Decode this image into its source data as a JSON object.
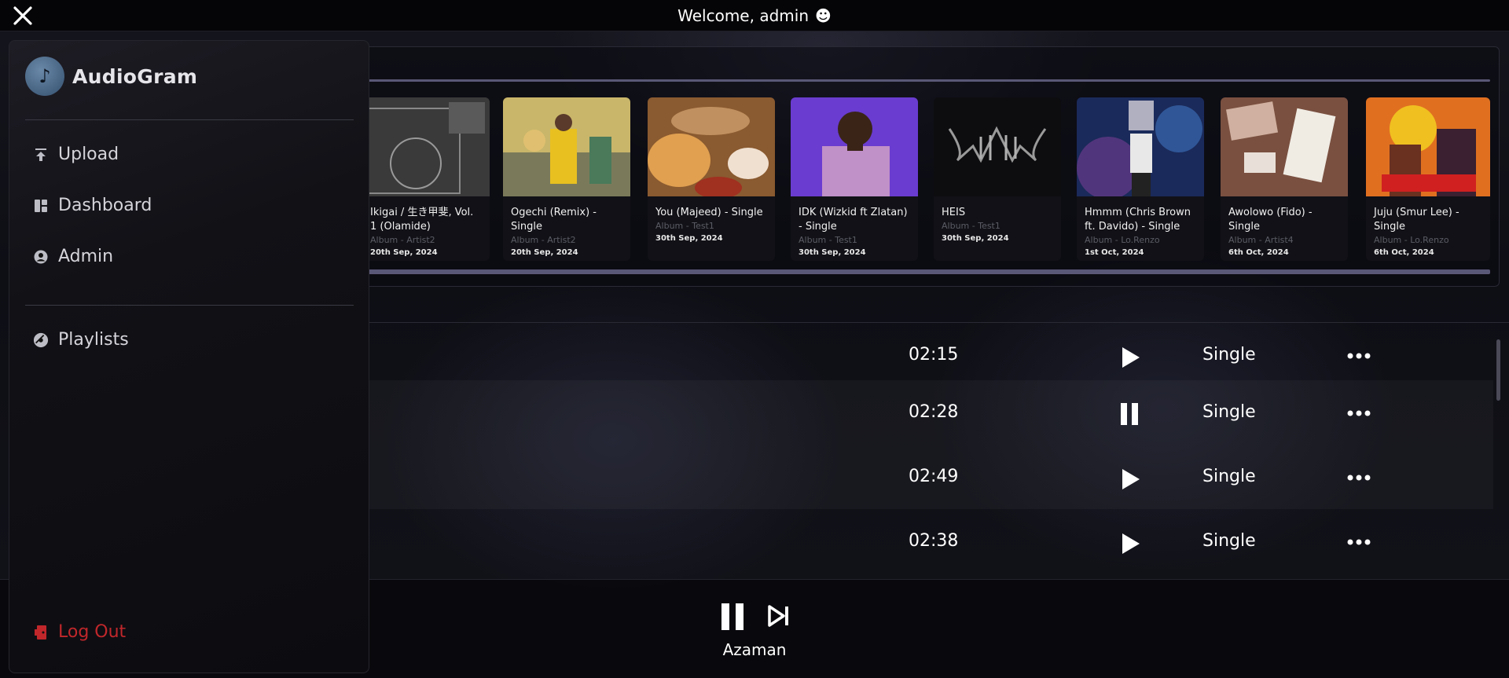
{
  "header": {
    "welcome": "Welcome, admin",
    "emoji": "☻"
  },
  "sidebar": {
    "app_name": "AudioGram",
    "nav": [
      {
        "label": "Upload",
        "icon": "upload-icon"
      },
      {
        "label": "Dashboard",
        "icon": "dashboard-icon"
      },
      {
        "label": "Admin",
        "icon": "user-circle-icon"
      }
    ],
    "playlists_label": "Playlists",
    "logout_label": "Log Out"
  },
  "carousel": [
    {
      "title": "Ikigai / 生き甲斐, Vol. 1 (Olamide)",
      "subtitle": "Album - Artist2",
      "date": "20th Sep, 2024"
    },
    {
      "title": "Ogechi (Remix) - Single",
      "subtitle": "Album - Artist2",
      "date": "20th Sep, 2024"
    },
    {
      "title": "You (Majeed) - Single",
      "subtitle": "Album - Test1",
      "date": "30th Sep, 2024"
    },
    {
      "title": "IDK (Wizkid ft Zlatan) - Single",
      "subtitle": "Album - Test1",
      "date": "30th Sep, 2024"
    },
    {
      "title": "HEIS",
      "subtitle": "Album - Test1",
      "date": "30th Sep, 2024"
    },
    {
      "title": "Hmmm (Chris Brown ft. Davido) - Single",
      "subtitle": "Album - Lo.Renzo",
      "date": "1st Oct, 2024"
    },
    {
      "title": "Awolowo (Fido) - Single",
      "subtitle": "Album - Artist4",
      "date": "6th Oct, 2024"
    },
    {
      "title": "Juju (Smur Lee) - Single",
      "subtitle": "Album - Lo.Renzo",
      "date": "6th Oct, 2024"
    }
  ],
  "tracks": [
    {
      "duration": "02:15",
      "state": "play",
      "type": "Single"
    },
    {
      "duration": "02:28",
      "state": "pause",
      "type": "Single"
    },
    {
      "duration": "02:49",
      "state": "play",
      "type": "Single"
    },
    {
      "duration": "02:38",
      "state": "play",
      "type": "Single"
    }
  ],
  "player": {
    "now_playing": "Azaman",
    "state": "playing"
  },
  "colors": {
    "accent_rail": "#5a5877",
    "logout": "#c0272b"
  }
}
